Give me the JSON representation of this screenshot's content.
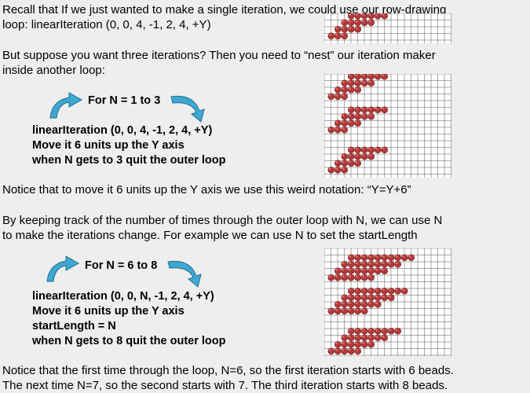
{
  "intro": {
    "line1": "Recall that If we just wanted to make a single iteration, we could use our row-drawing",
    "line2": "loop: linearIteration (0, 0, 4, -1, 2, 4, +Y)"
  },
  "nest": {
    "line1": "But suppose you want three iterations?  Then you need to “nest” our iteration maker",
    "line2": "inside another loop:"
  },
  "loop1": {
    "header": "For N = 1 to 3",
    "body": [
      "linearIteration (0, 0, 4, -1, 2, 4, +Y)",
      "Move it 6 units up the Y axis",
      "when N gets to 3 quit the outer loop"
    ]
  },
  "notice1": "Notice that to move it 6 units up the Y axis we use this weird notation: “Y=Y+6”",
  "tracking": {
    "line1": "By keeping track of the number of times through the outer loop with N, we can use N",
    "line2": "to make the iterations change. For example we can use N to set the startLength"
  },
  "loop2": {
    "header": "For N = 6 to 8",
    "body": [
      "linearIteration (0, 0, N, -1, 2, 4, +Y)",
      "Move it 6 units up the Y axis",
      "startLength = N",
      "when N gets to 8 quit the outer loop"
    ]
  },
  "notice2": {
    "line1": "Notice that the first time through the loop, N=6, so the first iteration starts with 6 beads.",
    "line2": "The next time N=7, so the second starts with 7.  The third iteration starts with 8 beads."
  },
  "colors": {
    "bead": "#b03a3a",
    "bead_highlight": "#e07070",
    "arrow": "#3fa8d0",
    "grid_line": "#555555",
    "grid_bg": "#ffffff"
  }
}
